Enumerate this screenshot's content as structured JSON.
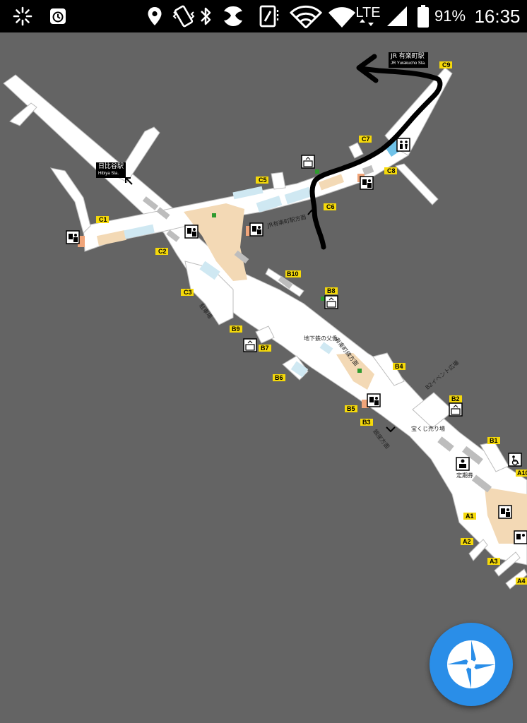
{
  "status_bar": {
    "battery_percent": "91%",
    "network_type": "LTE",
    "time": "16:35",
    "icons": [
      "loading-icon",
      "alarm-icon",
      "location-icon",
      "vibrate-icon",
      "bluetooth-icon",
      "data-saver-icon",
      "nfc-icon",
      "wifi-icon",
      "signal-icon",
      "battery-icon"
    ]
  },
  "station_signs": [
    {
      "id": "jr-yurakucho",
      "name": "JR 有楽町駅",
      "sub": "JR Yurakucho Sta."
    },
    {
      "id": "hibiya",
      "name": "日比谷駅",
      "sub": "Hibiya Sta."
    }
  ],
  "exits": [
    "C9",
    "C7",
    "C8",
    "C5",
    "C6",
    "C1",
    "C2",
    "C3",
    "B10",
    "B8",
    "B9",
    "B7",
    "B6",
    "B4",
    "B2",
    "B5",
    "B3",
    "B1",
    "A10",
    "A1",
    "A2",
    "A3",
    "A4"
  ],
  "labels": {
    "jr_direction": "JR有楽町駅方面",
    "underground_father": "地下鉄の父像",
    "tokyo_exchange": "銀座方面",
    "ticket_office": "定期券",
    "lottery": "宝くじ売り場",
    "event_plaza": "B2イベント広場",
    "parking": "駐車場",
    "yurakucho_line": "有楽町線方面",
    "east_direction": "東京駅・京橋方面"
  },
  "colors": {
    "map_background": "#646464",
    "corridor": "#ffffff",
    "exit_label": "#f5d90a",
    "shop": "#f3d9b5",
    "water": "#cfe8f2",
    "route": "#000000",
    "fab": "#2a8ee8"
  },
  "fab": {
    "icon": "aperture-icon"
  }
}
